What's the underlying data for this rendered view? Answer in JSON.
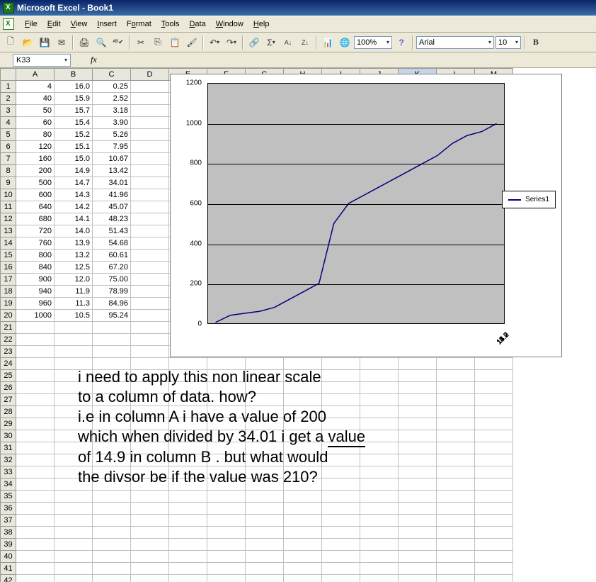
{
  "title": "Microsoft Excel - Book1",
  "menu": {
    "file": "File",
    "edit": "Edit",
    "view": "View",
    "insert": "Insert",
    "format": "Format",
    "tools": "Tools",
    "data": "Data",
    "window": "Window",
    "help": "Help"
  },
  "toolbar": {
    "zoom": "100%",
    "font": "Arial",
    "size": "10",
    "bold": "B"
  },
  "namebox": "K33",
  "fx": "fx",
  "columns": [
    "A",
    "B",
    "C",
    "D",
    "E",
    "F",
    "G",
    "H",
    "I",
    "J",
    "K",
    "L",
    "M"
  ],
  "rows_total": 42,
  "selected_col": "K",
  "selected_row": 33,
  "cells": {
    "A": [
      4,
      40,
      50,
      60,
      80,
      120,
      160,
      200,
      500,
      600,
      640,
      680,
      720,
      760,
      800,
      840,
      900,
      940,
      960,
      1000
    ],
    "B": [
      "16.0",
      "15.9",
      "15.7",
      "15.4",
      "15.2",
      "15.1",
      "15.0",
      "14.9",
      "14.7",
      "14.3",
      "14.2",
      "14.1",
      "14.0",
      "13.9",
      "13.2",
      "12.5",
      "12.0",
      "11.9",
      "11.3",
      "10.5"
    ],
    "C": [
      "0.25",
      "2.52",
      "3.18",
      "3.90",
      "5.26",
      "7.95",
      "10.67",
      "13.42",
      "34.01",
      "41.96",
      "45.07",
      "48.23",
      "51.43",
      "54.68",
      "60.61",
      "67.20",
      "75.00",
      "78.99",
      "84.96",
      "95.24"
    ]
  },
  "chart_data": {
    "type": "line",
    "categories": [
      "16.0",
      "15.7",
      "15.2",
      "15.0",
      "14.7",
      "14.2",
      "14.0",
      "13.2",
      "12.0",
      "11.3"
    ],
    "series": [
      {
        "name": "Series1",
        "values": [
          4,
          40,
          50,
          60,
          80,
          120,
          160,
          200,
          500,
          600,
          640,
          680,
          720,
          760,
          800,
          840,
          900,
          940,
          960,
          1000
        ]
      }
    ],
    "x_full": [
      "16.0",
      "15.9",
      "15.7",
      "15.4",
      "15.2",
      "15.1",
      "15.0",
      "14.9",
      "14.7",
      "14.3",
      "14.2",
      "14.1",
      "14.0",
      "13.9",
      "13.2",
      "12.5",
      "12.0",
      "11.9",
      "11.3",
      "10.5"
    ],
    "ylim": [
      0,
      1200
    ],
    "yticks": [
      0,
      200,
      400,
      600,
      800,
      1000,
      1200
    ],
    "legend": "Series1"
  },
  "note_lines": [
    "i need to apply this non linear scale",
    "to a column of data. how?",
    "i.e in column A i have a value of 200",
    "which when divided by 34.01 i get a ",
    "of 14.9 in column B . but what would",
    "the divsor be if the value was 210?"
  ],
  "note_u_word": "value"
}
